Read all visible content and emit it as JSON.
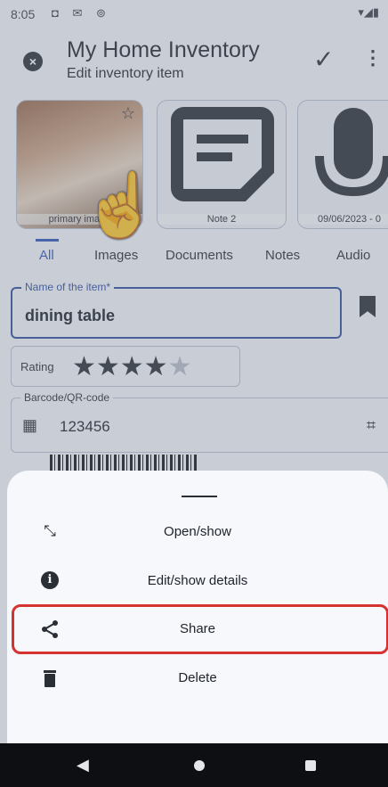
{
  "status_bar": {
    "time": "8:05",
    "left_icons": "◘ ✉ ⊚",
    "right_icons": "▾◢▮"
  },
  "app_bar": {
    "title": "My Home Inventory",
    "subtitle": "Edit inventory item",
    "close_icon": "×",
    "check_icon": "✓",
    "more_icon": "⋮"
  },
  "attachments": [
    {
      "label": "primary image",
      "type": "image"
    },
    {
      "label": "Note 2",
      "type": "note"
    },
    {
      "label": "09/06/2023 - 0",
      "type": "audio"
    }
  ],
  "tabs": [
    "All",
    "Images",
    "Documents",
    "Notes",
    "Audio"
  ],
  "active_tab": "All",
  "name_field": {
    "legend": "Name of the item*",
    "value": "dining table"
  },
  "rating": {
    "label": "Rating",
    "value": 4,
    "max": 5,
    "filled": "★★★★",
    "empty": "★"
  },
  "barcode_field": {
    "legend": "Barcode/QR-code",
    "value": "123456"
  },
  "sheet": {
    "items": [
      {
        "label": "Open/show",
        "icon": "expand-icon",
        "glyph": "⤡"
      },
      {
        "label": "Edit/show details",
        "icon": "info-icon",
        "glyph": "i"
      },
      {
        "label": "Share",
        "icon": "share-icon",
        "glyph": "<"
      },
      {
        "label": "Delete",
        "icon": "trash-icon",
        "glyph": "🗑"
      }
    ]
  },
  "nav": {
    "back_glyph": "◀"
  },
  "colors": {
    "accent": "#2f56b8",
    "highlight": "#d63232",
    "navbar": "#0d0f12"
  }
}
